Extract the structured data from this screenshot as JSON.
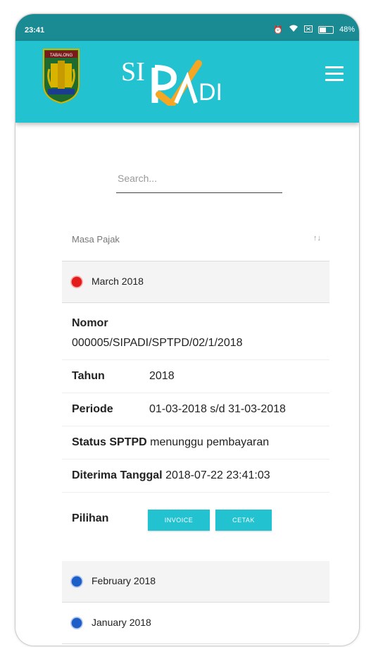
{
  "status_bar": {
    "time": "23:41",
    "battery": "48%"
  },
  "header": {
    "app_name_prefix": "SI",
    "app_name_suffix": "DI",
    "emblem_text": "TABALONG"
  },
  "search": {
    "placeholder": "Search..."
  },
  "list": {
    "sort_header": "Masa Pajak",
    "groups": [
      {
        "label": "March 2018",
        "status_color": "#e21b1b",
        "expanded": true
      },
      {
        "label": "February 2018",
        "status_color": "#1e5fc7"
      },
      {
        "label": "January 2018",
        "status_color": "#1e5fc7"
      }
    ]
  },
  "detail": {
    "nomor_label": "Nomor",
    "nomor_value": "000005/SIPADI/SPTPD/02/1/2018",
    "tahun_label": "Tahun",
    "tahun_value": "2018",
    "periode_label": "Periode",
    "periode_value": "01-03-2018 s/d 31-03-2018",
    "status_label": "Status SPTPD",
    "status_value": "menunggu pembayaran",
    "diterima_label": "Diterima Tanggal",
    "diterima_value": "2018-07-22 23:41:03",
    "pilihan_label": "Pilihan",
    "invoice_button": "INVOICE",
    "cetak_button": "CETAK"
  },
  "colors": {
    "accent": "#22c2d1",
    "status_bar": "#1a8a93",
    "logo_orange": "#f5a623"
  }
}
